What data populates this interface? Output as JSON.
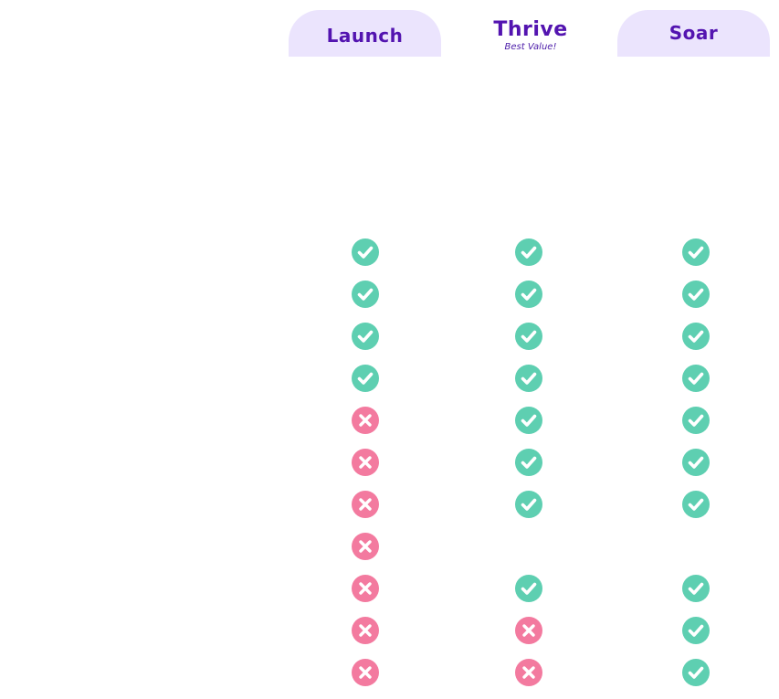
{
  "plans": [
    {
      "name": "Launch",
      "subtitle": null,
      "highlighted_tab": true
    },
    {
      "name": "Thrive",
      "subtitle": "Best Value!",
      "highlighted_tab": false
    },
    {
      "name": "Soar",
      "subtitle": null,
      "highlighted_tab": true
    }
  ],
  "colors": {
    "brand_text": "#5314b0",
    "tab_background": "#ebe4fd",
    "check": "#5ecfb1",
    "cross": "#f37a9f"
  },
  "icon_legend": {
    "yes": "check-icon",
    "no": "cross-icon",
    "none": "empty"
  },
  "features": [
    [
      "yes",
      "yes",
      "yes"
    ],
    [
      "yes",
      "yes",
      "yes"
    ],
    [
      "yes",
      "yes",
      "yes"
    ],
    [
      "yes",
      "yes",
      "yes"
    ],
    [
      "no",
      "yes",
      "yes"
    ],
    [
      "no",
      "yes",
      "yes"
    ],
    [
      "no",
      "yes",
      "yes"
    ],
    [
      "no",
      "none",
      "none"
    ],
    [
      "no",
      "yes",
      "yes"
    ],
    [
      "no",
      "no",
      "yes"
    ],
    [
      "no",
      "no",
      "yes"
    ]
  ]
}
